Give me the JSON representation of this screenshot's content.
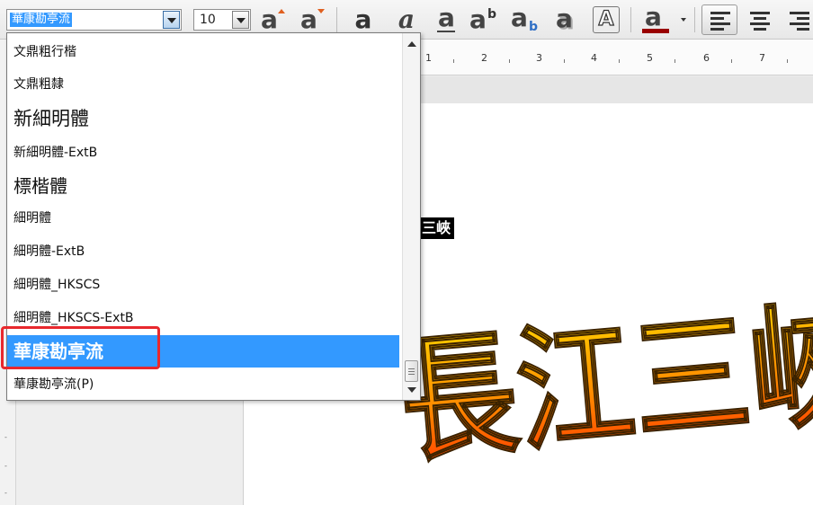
{
  "toolbar": {
    "font_name": "華康勘亭流",
    "font_size": "10",
    "icons": [
      "grow-font-icon",
      "shrink-font-icon",
      "bold-icon",
      "italic-icon",
      "underline-icon",
      "superscript-icon",
      "subscript-icon",
      "shadow-icon",
      "outline-icon",
      "font-color-icon",
      "align-left-icon",
      "align-center-icon",
      "align-right-icon"
    ],
    "font_color": "#990000"
  },
  "ruler": {
    "numbers": [
      "1",
      "2",
      "3",
      "4",
      "5",
      "6",
      "7"
    ]
  },
  "font_list": {
    "items": [
      {
        "label": "文鼎粗行楷",
        "selected": false
      },
      {
        "label": "文鼎粗隸",
        "selected": false
      },
      {
        "label": "新細明體",
        "selected": false
      },
      {
        "label": "新細明體-ExtB",
        "selected": false
      },
      {
        "label": "標楷體",
        "selected": false
      },
      {
        "label": "細明體",
        "selected": false
      },
      {
        "label": "細明體-ExtB",
        "selected": false
      },
      {
        "label": "細明體_HKSCS",
        "selected": false
      },
      {
        "label": "細明體_HKSCS-ExtB",
        "selected": false
      },
      {
        "label": "華康勘亭流",
        "selected": true
      },
      {
        "label": "華康勘亭流(P)",
        "selected": false
      }
    ]
  },
  "document": {
    "selected_text": "三峽",
    "wordart_text": "長江三峽",
    "wordart_colors": [
      "#ffd400",
      "#ff8a00",
      "#ff3300"
    ]
  }
}
